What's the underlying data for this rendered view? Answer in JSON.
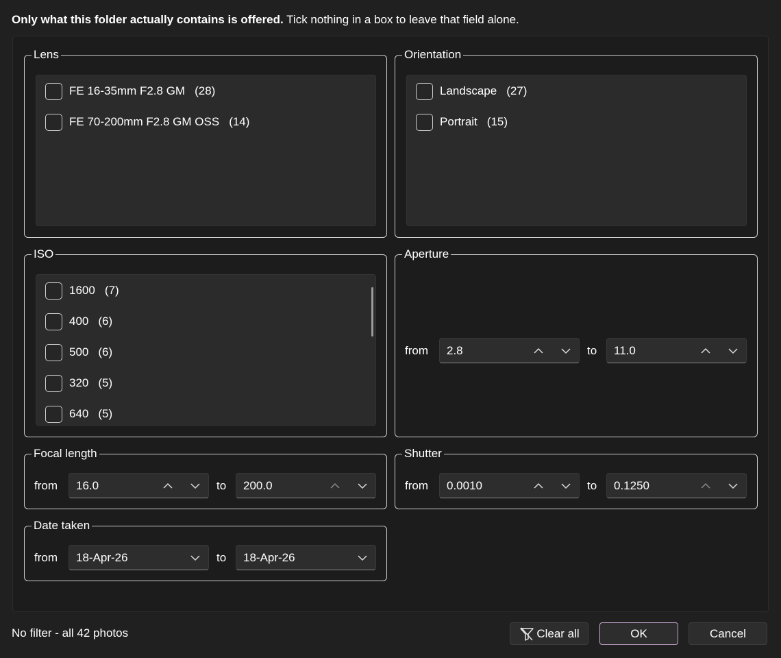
{
  "intro": {
    "bold": "Only what this folder actually contains is offered.",
    "normal": "Tick nothing in a box to leave that field alone."
  },
  "lens": {
    "title": "Lens",
    "items": [
      {
        "label": "FE 16-35mm F2.8 GM",
        "count": "(28)",
        "checked": false
      },
      {
        "label": "FE 70-200mm F2.8 GM OSS",
        "count": "(14)",
        "checked": false
      }
    ]
  },
  "orientation": {
    "title": "Orientation",
    "items": [
      {
        "label": "Landscape",
        "count": "(27)",
        "checked": false
      },
      {
        "label": "Portrait",
        "count": "(15)",
        "checked": false
      }
    ]
  },
  "iso": {
    "title": "ISO",
    "items": [
      {
        "label": "1600",
        "count": "(7)",
        "checked": false
      },
      {
        "label": "400",
        "count": "(6)",
        "checked": false
      },
      {
        "label": "500",
        "count": "(6)",
        "checked": false
      },
      {
        "label": "320",
        "count": "(5)",
        "checked": false
      },
      {
        "label": "640",
        "count": "(5)",
        "checked": false
      }
    ]
  },
  "aperture": {
    "title": "Aperture",
    "from_label": "from",
    "from": "2.8",
    "to_label": "to",
    "to": "11.0"
  },
  "focal": {
    "title": "Focal length",
    "from_label": "from",
    "from": "16.0",
    "to_label": "to",
    "to": "200.0"
  },
  "shutter": {
    "title": "Shutter",
    "from_label": "from",
    "from": "0.0010",
    "to_label": "to",
    "to": "0.1250"
  },
  "date": {
    "title": "Date taken",
    "from_label": "from",
    "from": "18-Apr-26",
    "to_label": "to",
    "to": "18-Apr-26"
  },
  "status": "No filter - all 42 photos",
  "buttons": {
    "clear": "Clear all",
    "ok": "OK",
    "cancel": "Cancel"
  },
  "icons": {
    "clear": "filter-off-icon",
    "up": "chevron-up-icon",
    "down": "chevron-down-icon"
  },
  "colors": {
    "background": "#202020",
    "field": "#2d2d2d",
    "accent": "#c9a3cf",
    "border": "#cfcfcf"
  }
}
